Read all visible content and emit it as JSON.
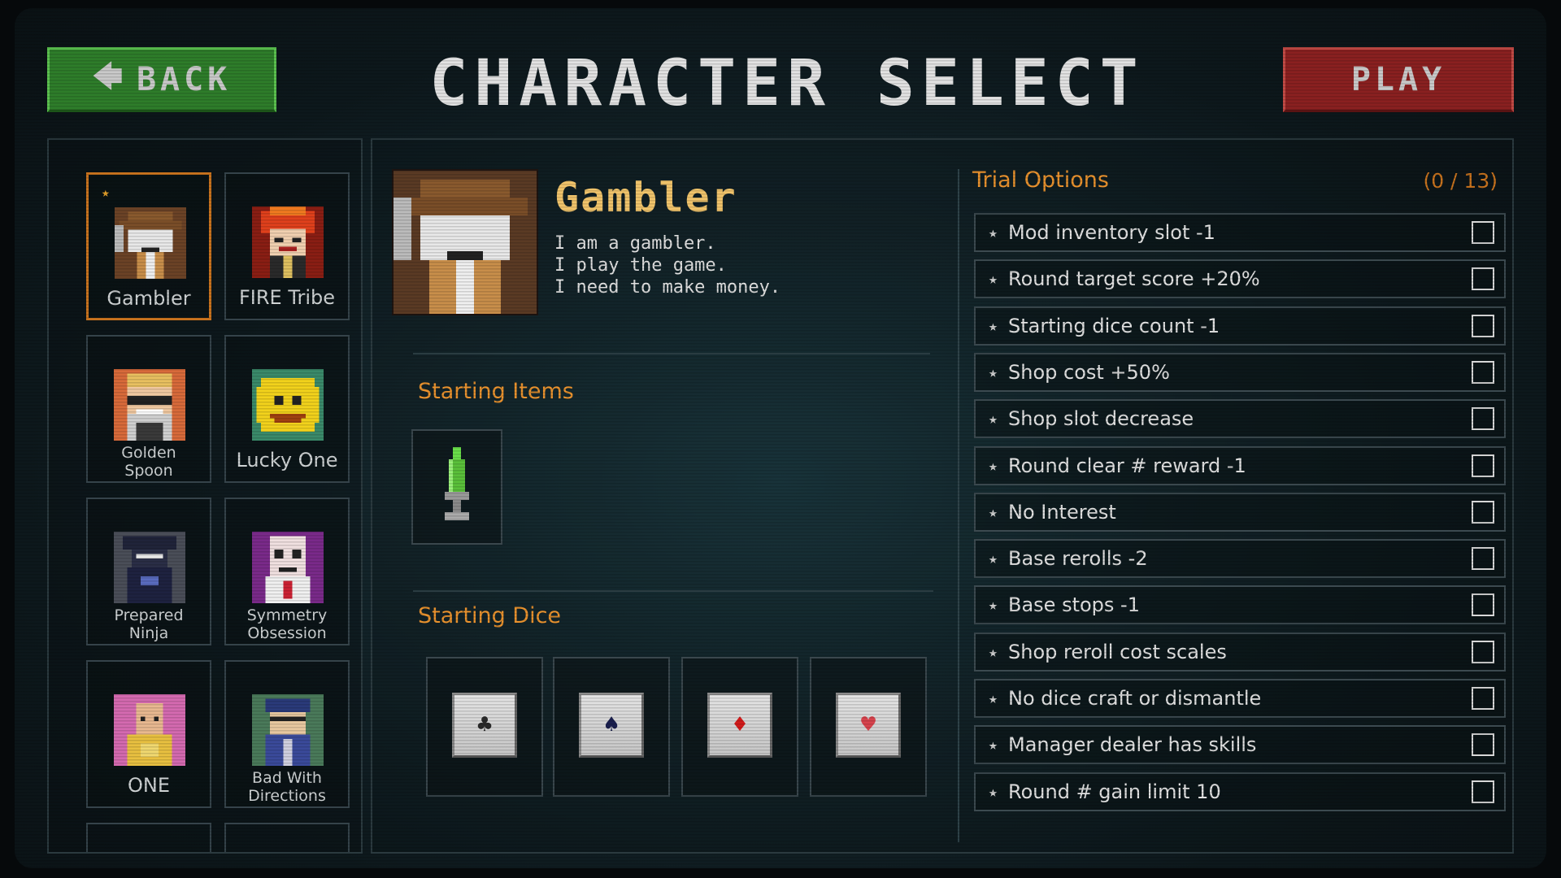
{
  "header": {
    "back_label": "BACK",
    "title": "CHARACTER SELECT",
    "play_label": "PLAY"
  },
  "characters": [
    {
      "name": "Gambler",
      "selected": true,
      "starred": true
    },
    {
      "name": "FIRE Tribe"
    },
    {
      "name": "Golden Spoon",
      "line1": "Golden",
      "line2": "Spoon"
    },
    {
      "name": "Lucky One"
    },
    {
      "name": "Prepared Ninja",
      "line1": "Prepared",
      "line2": "Ninja"
    },
    {
      "name": "Symmetry Obsession",
      "line1": "Symmetry",
      "line2": "Obsession"
    },
    {
      "name": "ONE"
    },
    {
      "name": "Bad With Directions",
      "line1": "Bad With",
      "line2": "Directions"
    }
  ],
  "selected": {
    "name": "Gambler",
    "description": [
      "I am a gambler.",
      "I play the game.",
      "I need to make money."
    ]
  },
  "sections": {
    "starting_items": "Starting Items",
    "starting_dice": "Starting Dice"
  },
  "starting_items": [
    {
      "icon": "syringe-icon"
    }
  ],
  "starting_dice": [
    {
      "suit": "club",
      "glyph": "♣",
      "color": "#2a2a2a"
    },
    {
      "suit": "spade",
      "glyph": "♠",
      "color": "#1a1f4e"
    },
    {
      "suit": "diamond",
      "glyph": "♦",
      "color": "#d21a1a"
    },
    {
      "suit": "heart",
      "glyph": "♥",
      "color": "#d8434d"
    }
  ],
  "trial": {
    "header": "Trial Options",
    "count": "(0 / 13)",
    "options": [
      "Mod inventory slot -1",
      "Round target score +20%",
      "Starting dice count -1",
      "Shop cost +50%",
      "Shop slot decrease",
      "Round clear # reward -1",
      "No Interest",
      "Base rerolls -2",
      "Base stops -1",
      "Shop reroll cost scales",
      "No dice craft or dismantle",
      "Manager dealer has skills",
      "Round # gain limit 10"
    ]
  },
  "colors": {
    "accent_orange": "#e9922e",
    "gold_title": "#f1c46b",
    "back_green": "#2e7d2a",
    "play_red": "#8a2020"
  }
}
